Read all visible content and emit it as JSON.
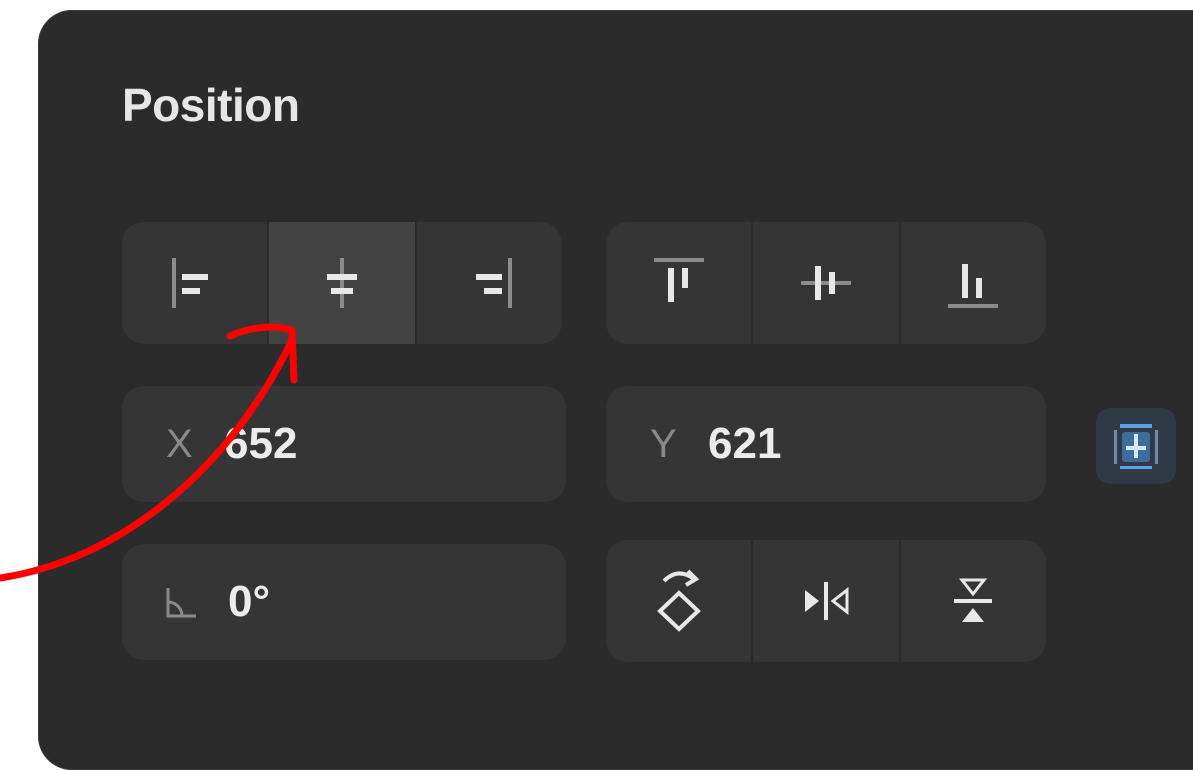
{
  "panel": {
    "title": "Position"
  },
  "alignment": {
    "horizontal": [
      {
        "icon": "align-left-icon",
        "active": false
      },
      {
        "icon": "align-horizontal-center-icon",
        "active": true
      },
      {
        "icon": "align-right-icon",
        "active": false
      }
    ],
    "vertical": [
      {
        "icon": "align-top-icon",
        "active": false
      },
      {
        "icon": "align-vertical-center-icon",
        "active": false
      },
      {
        "icon": "align-bottom-icon",
        "active": false
      }
    ]
  },
  "position": {
    "x_label": "X",
    "x_value": "652",
    "y_label": "Y",
    "y_value": "621"
  },
  "rotation": {
    "label_icon": "angle-icon",
    "value": "0°"
  },
  "transform": [
    {
      "icon": "rotate-90-icon"
    },
    {
      "icon": "flip-horizontal-icon"
    },
    {
      "icon": "flip-vertical-icon"
    }
  ],
  "constraint": {
    "icon": "constraint-pin-icon"
  },
  "annotation": {
    "color": "#ff0000",
    "icon": "red-arrow-annotation"
  },
  "colors": {
    "panel_bg": "#2b2b2b",
    "control_bg": "#353535",
    "active_bg": "#434343",
    "accent": "#5aa2e6"
  }
}
